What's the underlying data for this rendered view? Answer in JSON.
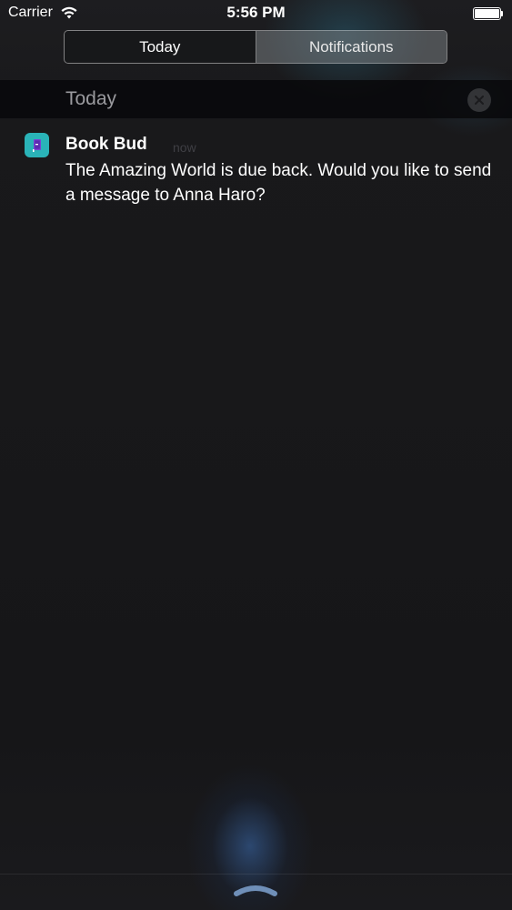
{
  "status_bar": {
    "carrier": "Carrier",
    "time": "5:56 PM",
    "wifi_icon": "wifi-icon",
    "battery_icon": "battery-icon",
    "battery_level_percent": 100
  },
  "segmented_control": {
    "selected_index": 0,
    "segments": [
      {
        "label": "Today"
      },
      {
        "label": "Notifications"
      }
    ]
  },
  "section": {
    "title": "Today",
    "clear_icon": "close-icon"
  },
  "notification": {
    "app_icon": "book-bud-app-icon",
    "app_name": "Book Bud",
    "time": "now",
    "body": "The Amazing World is due back. Would you like to send a message to Anna Haro?"
  },
  "bottom": {
    "grabber_icon": "chevron-up-icon"
  },
  "colors": {
    "app_icon_bg": "#2ab3b8",
    "app_icon_book": "#7a3fd6",
    "background": "#161618"
  }
}
